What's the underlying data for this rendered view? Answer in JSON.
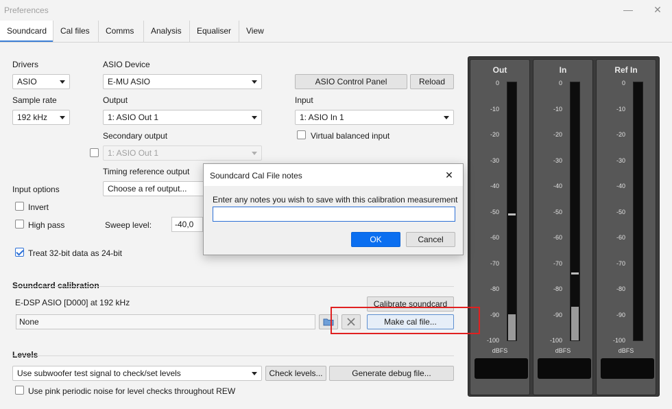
{
  "window": {
    "title": "Preferences",
    "minimize": "—",
    "close": "✕"
  },
  "tabs": [
    "Soundcard",
    "Cal files",
    "Comms",
    "Analysis",
    "Equaliser",
    "View"
  ],
  "drivers": {
    "label": "Drivers",
    "value": "ASIO"
  },
  "asio_device": {
    "label": "ASIO Device",
    "value": "E-MU ASIO"
  },
  "asio_control_panel": "ASIO Control Panel",
  "reload": "Reload",
  "sample_rate": {
    "label": "Sample rate",
    "value": "192 kHz"
  },
  "output": {
    "label": "Output",
    "value": "1: ASIO Out 1"
  },
  "input": {
    "label": "Input",
    "value": "1: ASIO In 1"
  },
  "virtual_balanced": "Virtual balanced input",
  "secondary_output": {
    "label": "Secondary output",
    "value": "1: ASIO Out 1"
  },
  "timing_ref": {
    "label": "Timing reference output",
    "value": "Choose a ref output..."
  },
  "input_options": {
    "label": "Input options",
    "invert": "Invert",
    "high_pass": "High pass"
  },
  "sweep_level": {
    "label": "Sweep level:",
    "value": "-40,0"
  },
  "treat_32bit": "Treat 32-bit data as 24-bit",
  "calibration": {
    "title": "Soundcard calibration",
    "device_info": "E-DSP ASIO [D000] at 192 kHz",
    "calibrate_button": "Calibrate soundcard",
    "file_value": "None",
    "make_cal_button": "Make cal file..."
  },
  "levels": {
    "title": "Levels",
    "mode_value": "Use subwoofer test signal to check/set levels",
    "check_button": "Check levels...",
    "debug_button": "Generate debug file...",
    "pink_noise": "Use pink periodic noise for level checks throughout REW"
  },
  "meters": {
    "scale": [
      "0",
      "-10",
      "-20",
      "-30",
      "-40",
      "-50",
      "-60",
      "-70",
      "-80",
      "-90",
      "-100"
    ],
    "unit": "dBFS",
    "channels": [
      {
        "name": "Out",
        "level_db": -90,
        "peak_db": -51
      },
      {
        "name": "In",
        "level_db": -87,
        "peak_db": -74
      },
      {
        "name": "Ref In",
        "level_db": null,
        "peak_db": null
      }
    ]
  },
  "dialog": {
    "title": "Soundcard Cal File notes",
    "close": "✕",
    "prompt": "Enter any notes you wish to save with this calibration measurement",
    "notes_value": "",
    "ok": "OK",
    "cancel": "Cancel"
  }
}
